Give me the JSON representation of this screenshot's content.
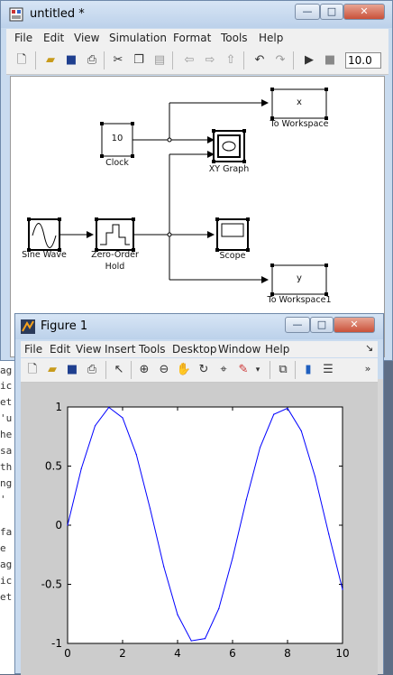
{
  "simulink": {
    "title": "untitled *",
    "menu": [
      "File",
      "Edit",
      "View",
      "Simulation",
      "Format",
      "Tools",
      "Help"
    ],
    "stop_time": "10.0",
    "blocks": {
      "clock": {
        "label": "Clock",
        "value": "10"
      },
      "sine": {
        "label": "Sine Wave"
      },
      "zoh": {
        "label": "Zero-Order",
        "label2": "Hold"
      },
      "xy": {
        "label": "XY Graph"
      },
      "scope": {
        "label": "Scope"
      },
      "tw1": {
        "label": "To Workspace",
        "var": "x"
      },
      "tw2": {
        "label": "To Workspace1",
        "var": "y"
      }
    }
  },
  "figure": {
    "title": "Figure 1",
    "menu": [
      "File",
      "Edit",
      "View",
      "Insert",
      "Tools",
      "Desktop",
      "Window",
      "Help"
    ]
  },
  "terminal_fragments": [
    "ag",
    "ic",
    "et",
    "'u",
    "he",
    "sa",
    "th",
    "ng",
    "'",
    "",
    "fa",
    "e",
    "ag",
    "ic",
    "et"
  ],
  "chart_data": {
    "type": "line",
    "x": [
      0,
      0.5,
      1,
      1.5,
      2,
      2.5,
      3,
      3.5,
      4,
      4.5,
      5,
      5.5,
      6,
      6.5,
      7,
      7.5,
      8,
      8.5,
      9,
      9.5,
      10
    ],
    "series": [
      {
        "values": [
          0,
          0.479,
          0.841,
          0.997,
          0.909,
          0.598,
          0.141,
          -0.351,
          -0.757,
          -0.978,
          -0.959,
          -0.706,
          -0.279,
          0.215,
          0.657,
          0.938,
          0.989,
          0.798,
          0.412,
          -0.075,
          -0.544
        ],
        "color": "#0000ff"
      }
    ],
    "xlim": [
      0,
      10
    ],
    "ylim": [
      -1,
      1
    ],
    "xticks": [
      "0",
      "2",
      "4",
      "6",
      "8",
      "10"
    ],
    "yticks": [
      "1",
      "0.5",
      "0",
      "-0.5",
      "-1"
    ]
  }
}
